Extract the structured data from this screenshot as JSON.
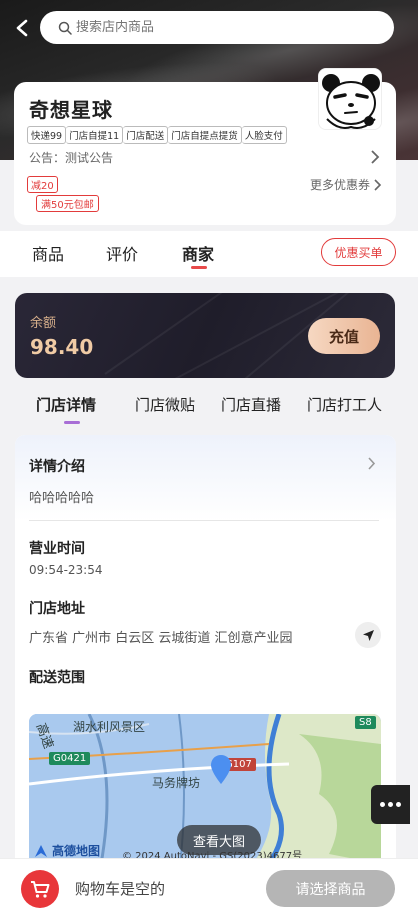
{
  "header": {
    "search_placeholder": "搜索店内商品"
  },
  "store": {
    "name": "奇想星球",
    "tags": [
      "快递99",
      "门店自提11",
      "门店配送",
      "门店自提点提货",
      "人脸支付"
    ],
    "notice": "公告：测试公告",
    "coupon_discount": "减20",
    "coupon_free_shipping": "满50元包邮",
    "more_coupons": "更多优惠券"
  },
  "tabs": {
    "items": [
      "商品",
      "评价",
      "商家"
    ],
    "active": "商家",
    "pay_button": "优惠买单"
  },
  "balance": {
    "label": "余额",
    "value": "98.40",
    "recharge_label": "充值"
  },
  "sub_tabs": {
    "items": [
      "门店详情",
      "门店微贴",
      "门店直播",
      "门店打工人"
    ],
    "active": "门店详情"
  },
  "details": {
    "intro_title": "详情介绍",
    "intro_text": "哈哈哈哈哈",
    "hours_title": "营业时间",
    "hours_value": "09:54-23:54",
    "address_title": "门店地址",
    "address_value": "广东省 广州市 白云区 云城街道 汇创意产业园",
    "delivery_title": "配送范围"
  },
  "map": {
    "labels": {
      "scenic": "湖水利风景区",
      "gaosu": "高速",
      "place": "马务牌坊",
      "g0421": "G0421",
      "g107": "G107",
      "s8": "S8"
    },
    "view_button": "查看大图",
    "logo": "高德地图",
    "copyright": "© 2024 AutoNavi - GS(2023)4677号"
  },
  "cart": {
    "empty_text": "购物车是空的",
    "select_button": "请选择商品"
  },
  "colors": {
    "accent_red": "#e23b3b",
    "gold": "#f0cba5",
    "sub_tab_indicator": "#a86ed6"
  }
}
